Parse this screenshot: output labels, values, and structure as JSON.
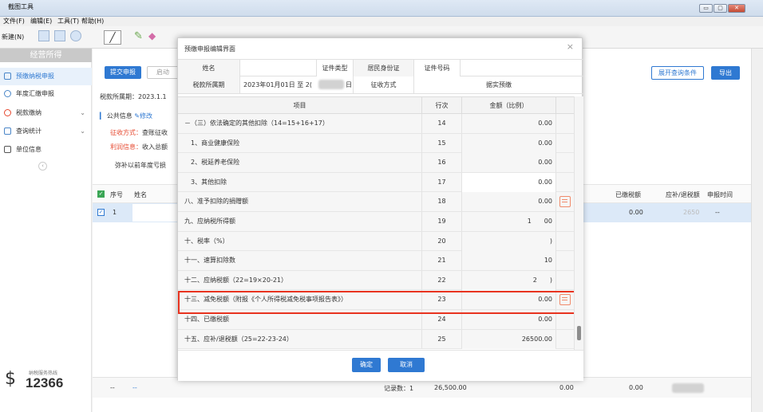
{
  "window": {
    "title": "截图工具",
    "min": "▭",
    "max": "▢",
    "close": "✕"
  },
  "menu": [
    "文件(F)",
    "编辑(E)",
    "工具(T)",
    "帮助(H)"
  ],
  "toolbar": {
    "new_label": "新建(N)"
  },
  "sidebar": {
    "header": "经营所得",
    "items": [
      {
        "label": "预缴纳税申报"
      },
      {
        "label": "年度汇缴申报"
      },
      {
        "label": "税款缴纳"
      },
      {
        "label": "查询统计"
      },
      {
        "label": "单位信息"
      }
    ],
    "hotline_label": "纳税服务热线",
    "hotline_number": "12366"
  },
  "main": {
    "submit": "提交申报",
    "start": "启动",
    "expand": "展开查询条件",
    "export": "导出",
    "period_label": "税款所属期：2023.1.1",
    "public_info": "公共信息",
    "edit": "修改",
    "collect_prefix": "征收方式：",
    "collect_value": "查账征收",
    "profit_prefix": "利润信息：",
    "profit_value": "收入总额",
    "loss_text": "弥补以前年度亏损",
    "grid_headers": {
      "seq": "序号",
      "name": "姓名",
      "paid": "已缴税额",
      "due": "应补/退税额",
      "time": "申报时间"
    },
    "grid_row": {
      "seq": "1",
      "paid": "0.00",
      "due": "2650",
      "time": "--"
    },
    "footer": {
      "c1": "--",
      "c2": "--",
      "count": "记录数：1",
      "total": "26,500.00",
      "zero1": "0.00",
      "zero2": "0.00"
    }
  },
  "modal": {
    "title": "预缴申报编辑界面",
    "close": "×",
    "info": {
      "name_label": "姓名",
      "id_type_label": "证件类型",
      "id_type_value": "居民身份证",
      "id_no_label": "证件号码",
      "period_label": "税款所属期",
      "period_value": "2023年01月01日 至 2(",
      "period_tail": "日",
      "method_label": "征收方式",
      "method_value": "据实预缴"
    },
    "headers": {
      "item": "项目",
      "seq": "行次",
      "amount": "金额（比例）"
    },
    "rows": [
      {
        "item": "－（三）依法确定的其他扣除（14=15+16+17）",
        "seq": "14",
        "amount": "0.00",
        "input": false,
        "icon": false
      },
      {
        "item": "　1、商业健康保险",
        "seq": "15",
        "amount": "0.00",
        "input": false,
        "icon": false
      },
      {
        "item": "　2、税延养老保险",
        "seq": "16",
        "amount": "0.00",
        "input": false,
        "icon": false
      },
      {
        "item": "　3、其他扣除",
        "seq": "17",
        "amount": "0.00",
        "input": true,
        "icon": false
      },
      {
        "item": "八、准予扣除的捐赠额",
        "seq": "18",
        "amount": "0.00",
        "input": false,
        "icon": true
      },
      {
        "item": "九、应纳税所得额",
        "seq": "19",
        "amount": "1　　00",
        "input": false,
        "icon": false
      },
      {
        "item": "十、税率（%）",
        "seq": "20",
        "amount": ")",
        "input": false,
        "icon": false
      },
      {
        "item": "十一、速算扣除数",
        "seq": "21",
        "amount": "10",
        "input": false,
        "icon": false
      },
      {
        "item": "十二、应纳税额（22=19×20-21）",
        "seq": "22",
        "amount": "2　　)",
        "input": false,
        "icon": false
      },
      {
        "item": "十三、减免税额（附报《个人所得税减免税事项报告表》）",
        "seq": "23",
        "amount": "0.00",
        "input": false,
        "icon": true
      },
      {
        "item": "十四、已缴税额",
        "seq": "24",
        "amount": "0.00",
        "input": false,
        "icon": false
      },
      {
        "item": "十五、应补/退税额（25=22-23-24）",
        "seq": "25",
        "amount": "26500.00",
        "input": false,
        "icon": false
      }
    ],
    "ok": "确定",
    "cancel": "取消"
  },
  "colors": {
    "accent": "#2f79d2",
    "highlight": "#e8331f",
    "edit_icon": "#f08a6a"
  }
}
